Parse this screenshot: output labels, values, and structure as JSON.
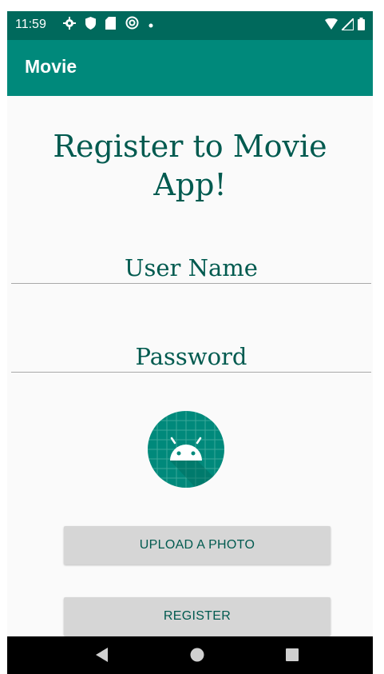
{
  "status_bar": {
    "time": "11:59",
    "icons_left": [
      "gear-icon",
      "shield-icon",
      "sd-card-icon",
      "sync-icon",
      "dot-icon"
    ],
    "icons_right": [
      "wifi-icon",
      "signal-icon",
      "battery-icon"
    ]
  },
  "app_bar": {
    "title": "Movie"
  },
  "main": {
    "heading_line1": "Register to Movie",
    "heading_line2": "App!",
    "username_hint": "User Name",
    "password_hint": "Password",
    "avatar_icon": "android-icon",
    "upload_button": "UPLOAD A PHOTO",
    "register_button": "REGISTER"
  },
  "nav_bar": {
    "buttons": [
      "back-icon",
      "home-icon",
      "recents-icon"
    ]
  },
  "colors": {
    "status_bar": "#00695c",
    "app_bar": "#00897b",
    "text_accent": "#005a4f",
    "button_bg": "#d6d6d6"
  }
}
